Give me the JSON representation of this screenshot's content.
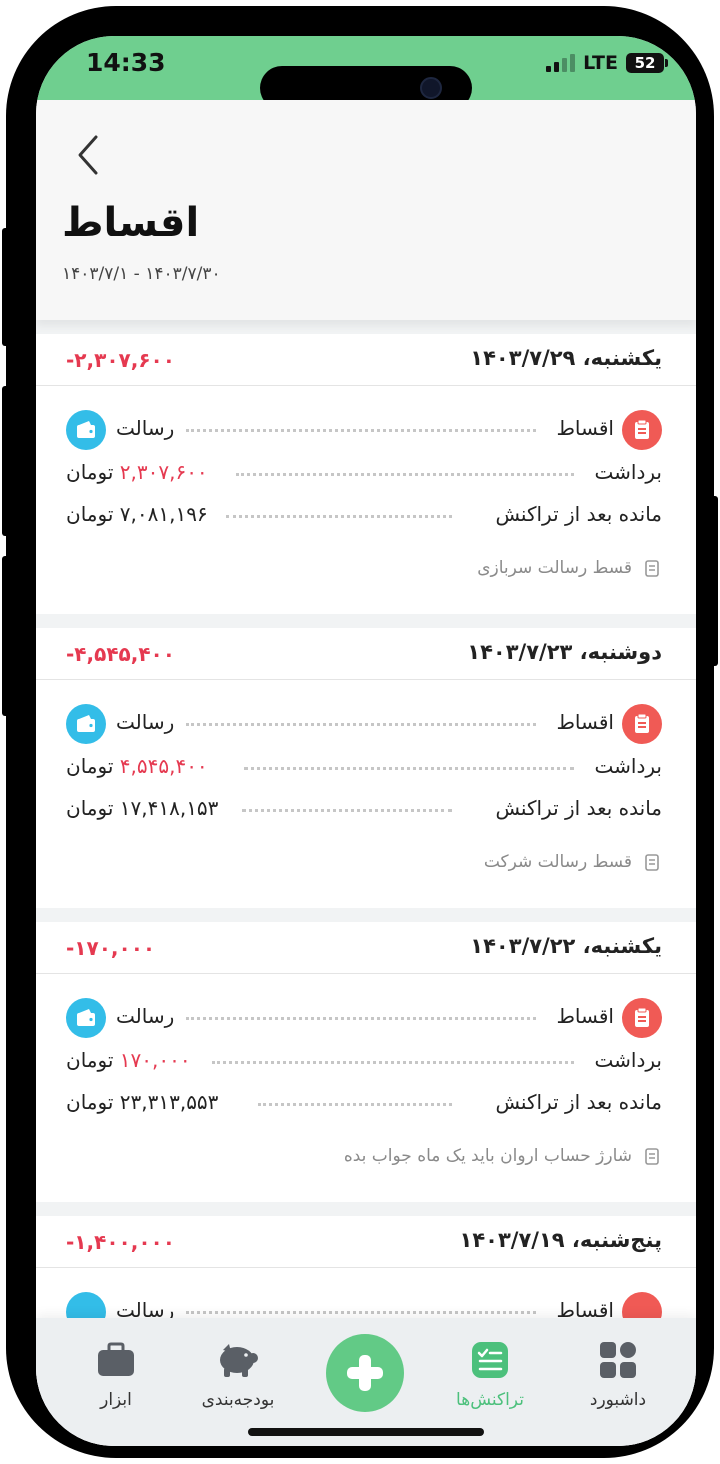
{
  "status_bar": {
    "time": "14:33",
    "network": "LTE",
    "battery": "52"
  },
  "header": {
    "back_icon": "chevron-left-icon",
    "title": "اقساط",
    "date_range": "۱۴۰۳/۷/۳۰ - ۱۴۰۳/۷/۱"
  },
  "labels": {
    "category": "اقساط",
    "account": "رسالت",
    "withdraw": "برداشت",
    "balance_after": "مانده بعد از تراکنش",
    "currency": "تومان"
  },
  "transactions": [
    {
      "date": "یکشنبه، ۱۴۰۳/۷/۲۹",
      "amount": "-۲,۳۰۷,۶۰۰",
      "withdraw_value": "۲,۳۰۷,۶۰۰",
      "balance_value": "۷,۰۸۱,۱۹۶",
      "note": "قسط رسالت سربازی"
    },
    {
      "date": "دوشنبه، ۱۴۰۳/۷/۲۳",
      "amount": "-۴,۵۴۵,۴۰۰",
      "withdraw_value": "۴,۵۴۵,۴۰۰",
      "balance_value": "۱۷,۴۱۸,۱۵۳",
      "note": "قسط رسالت شرکت"
    },
    {
      "date": "یکشنبه، ۱۴۰۳/۷/۲۲",
      "amount": "-۱۷۰,۰۰۰",
      "withdraw_value": "۱۷۰,۰۰۰",
      "balance_value": "۲۳,۳۱۳,۵۵۳",
      "note": "شارژ حساب اروان باید یک ماه جواب بده"
    },
    {
      "date": "پنج‌شنبه، ۱۴۰۳/۷/۱۹",
      "amount": "-۱,۴۰۰,۰۰۰"
    }
  ],
  "bottom_nav": {
    "items": [
      {
        "label": "داشبورد",
        "icon": "dashboard-grid-icon"
      },
      {
        "label": "تراکنش‌ها",
        "icon": "transactions-list-icon",
        "active": true
      },
      {
        "label": "بودجه‌بندی",
        "icon": "piggy-bank-icon"
      },
      {
        "label": "ابزار",
        "icon": "toolbox-icon"
      }
    ],
    "fab_icon": "plus-icon"
  },
  "colors": {
    "status_bar": "#6fcf8f",
    "accent_green": "#62ca86",
    "negative_red": "#e53950",
    "category_icon": "#f05a55",
    "account_icon": "#33bde8"
  }
}
